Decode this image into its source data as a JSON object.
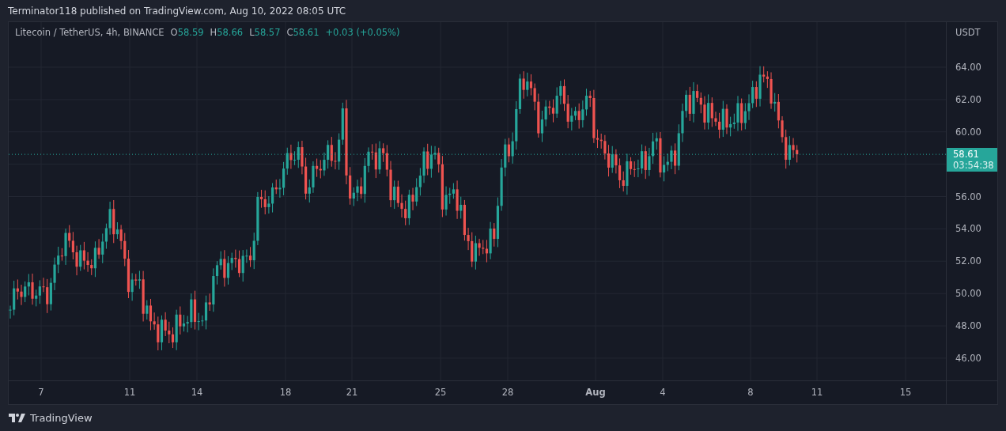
{
  "header": {
    "text": "Terminator118 published on TradingView.com, Aug 10, 2022 08:05 UTC"
  },
  "legend": {
    "symbol": "Litecoin / TetherUS, 4h, BINANCE",
    "values": [
      {
        "key": "O",
        "value": "58.59"
      },
      {
        "key": "H",
        "value": "58.66"
      },
      {
        "key": "L",
        "value": "58.57"
      },
      {
        "key": "C",
        "value": "58.61"
      }
    ],
    "change": "+0.03 (+0.05%)"
  },
  "price_axis": {
    "unit": "USDT",
    "ticks": [
      "64.00",
      "62.00",
      "60.00",
      "56.00",
      "54.00",
      "52.00",
      "50.00",
      "48.00",
      "46.00"
    ]
  },
  "last_price": {
    "price": "58.61",
    "countdown": "03:54:38"
  },
  "time_axis": {
    "ticks": [
      {
        "label": "7",
        "bold": false
      },
      {
        "label": "11",
        "bold": false
      },
      {
        "label": "14",
        "bold": false
      },
      {
        "label": "18",
        "bold": false
      },
      {
        "label": "21",
        "bold": false
      },
      {
        "label": "25",
        "bold": false
      },
      {
        "label": "28",
        "bold": false
      },
      {
        "label": "Aug",
        "bold": true
      },
      {
        "label": "4",
        "bold": false
      },
      {
        "label": "8",
        "bold": false
      },
      {
        "label": "11",
        "bold": false
      },
      {
        "label": "15",
        "bold": false
      }
    ]
  },
  "footer": {
    "brand": "TradingView"
  }
}
